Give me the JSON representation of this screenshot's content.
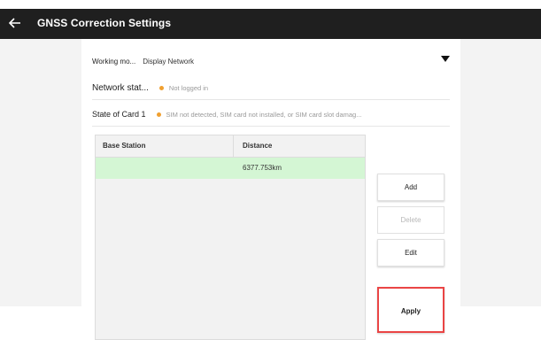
{
  "header": {
    "title": "GNSS Correction Settings",
    "back_icon": "arrow-left-icon"
  },
  "settings": {
    "working_mode_label": "Working mo...",
    "working_mode_value": "Display Network",
    "network_status_label": "Network stat...",
    "network_status_value": "Not logged in",
    "card_state_label": "State of Card 1",
    "card_state_value": "SIM not detected, SIM card not installed, or SIM card slot damag...",
    "status_dot_color": "#f0a030"
  },
  "table": {
    "columns": [
      "Base Station",
      "Distance"
    ],
    "rows": [
      {
        "base_station": "",
        "distance": "6377.753km"
      }
    ],
    "selected_row_color": "#d4f6d4"
  },
  "buttons": {
    "add": "Add",
    "delete": "Delete",
    "edit": "Edit",
    "apply": "Apply"
  },
  "colors": {
    "topbar": "#1f1f1f",
    "apply_highlight": "#ea4545"
  }
}
